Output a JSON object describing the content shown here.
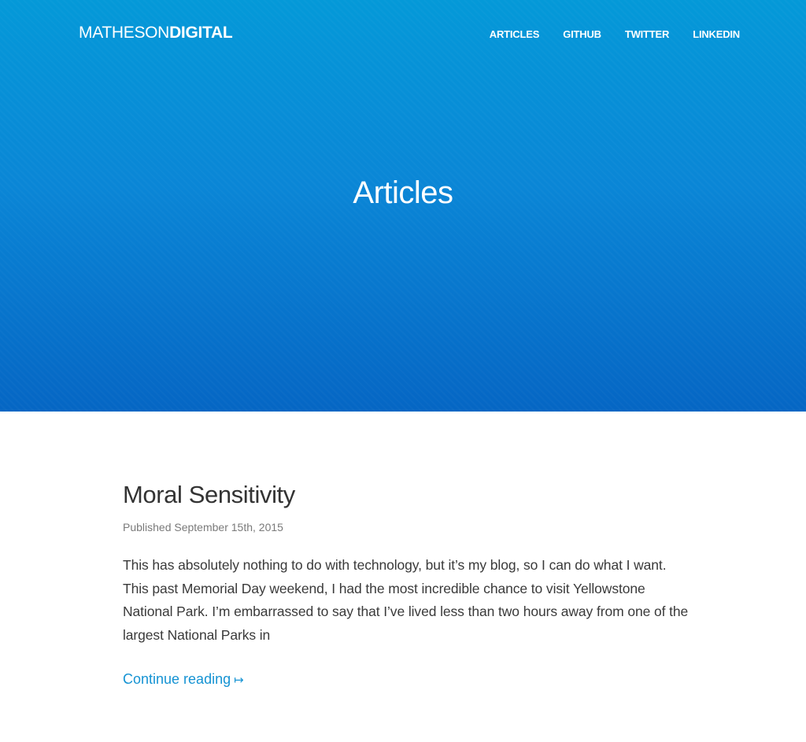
{
  "header": {
    "logo_light": "MATHESON",
    "logo_bold": "DIGITAL",
    "nav": [
      {
        "label": "ARTICLES"
      },
      {
        "label": "GITHUB"
      },
      {
        "label": "TWITTER"
      },
      {
        "label": "LINKEDIN"
      }
    ]
  },
  "hero": {
    "title": "Articles"
  },
  "post": {
    "title": "Moral Sensitivity",
    "date": "Published September 15th, 2015",
    "excerpt": "This has absolutely nothing to do with technology, but it’s my blog, so I can do what I want. This past Memorial Day weekend, I had the most incredible chance to visit Yellowstone National Park. I’m embarrassed to say that I’ve lived less than two hours away from one of the largest National Parks in",
    "continue_label": "Continue reading",
    "continue_arrow": "↦"
  },
  "colors": {
    "hero_top": "#0499d8",
    "hero_bottom": "#0566c4",
    "link": "#1593d3",
    "title_text": "#333333",
    "meta_text": "#7a7a7a"
  }
}
